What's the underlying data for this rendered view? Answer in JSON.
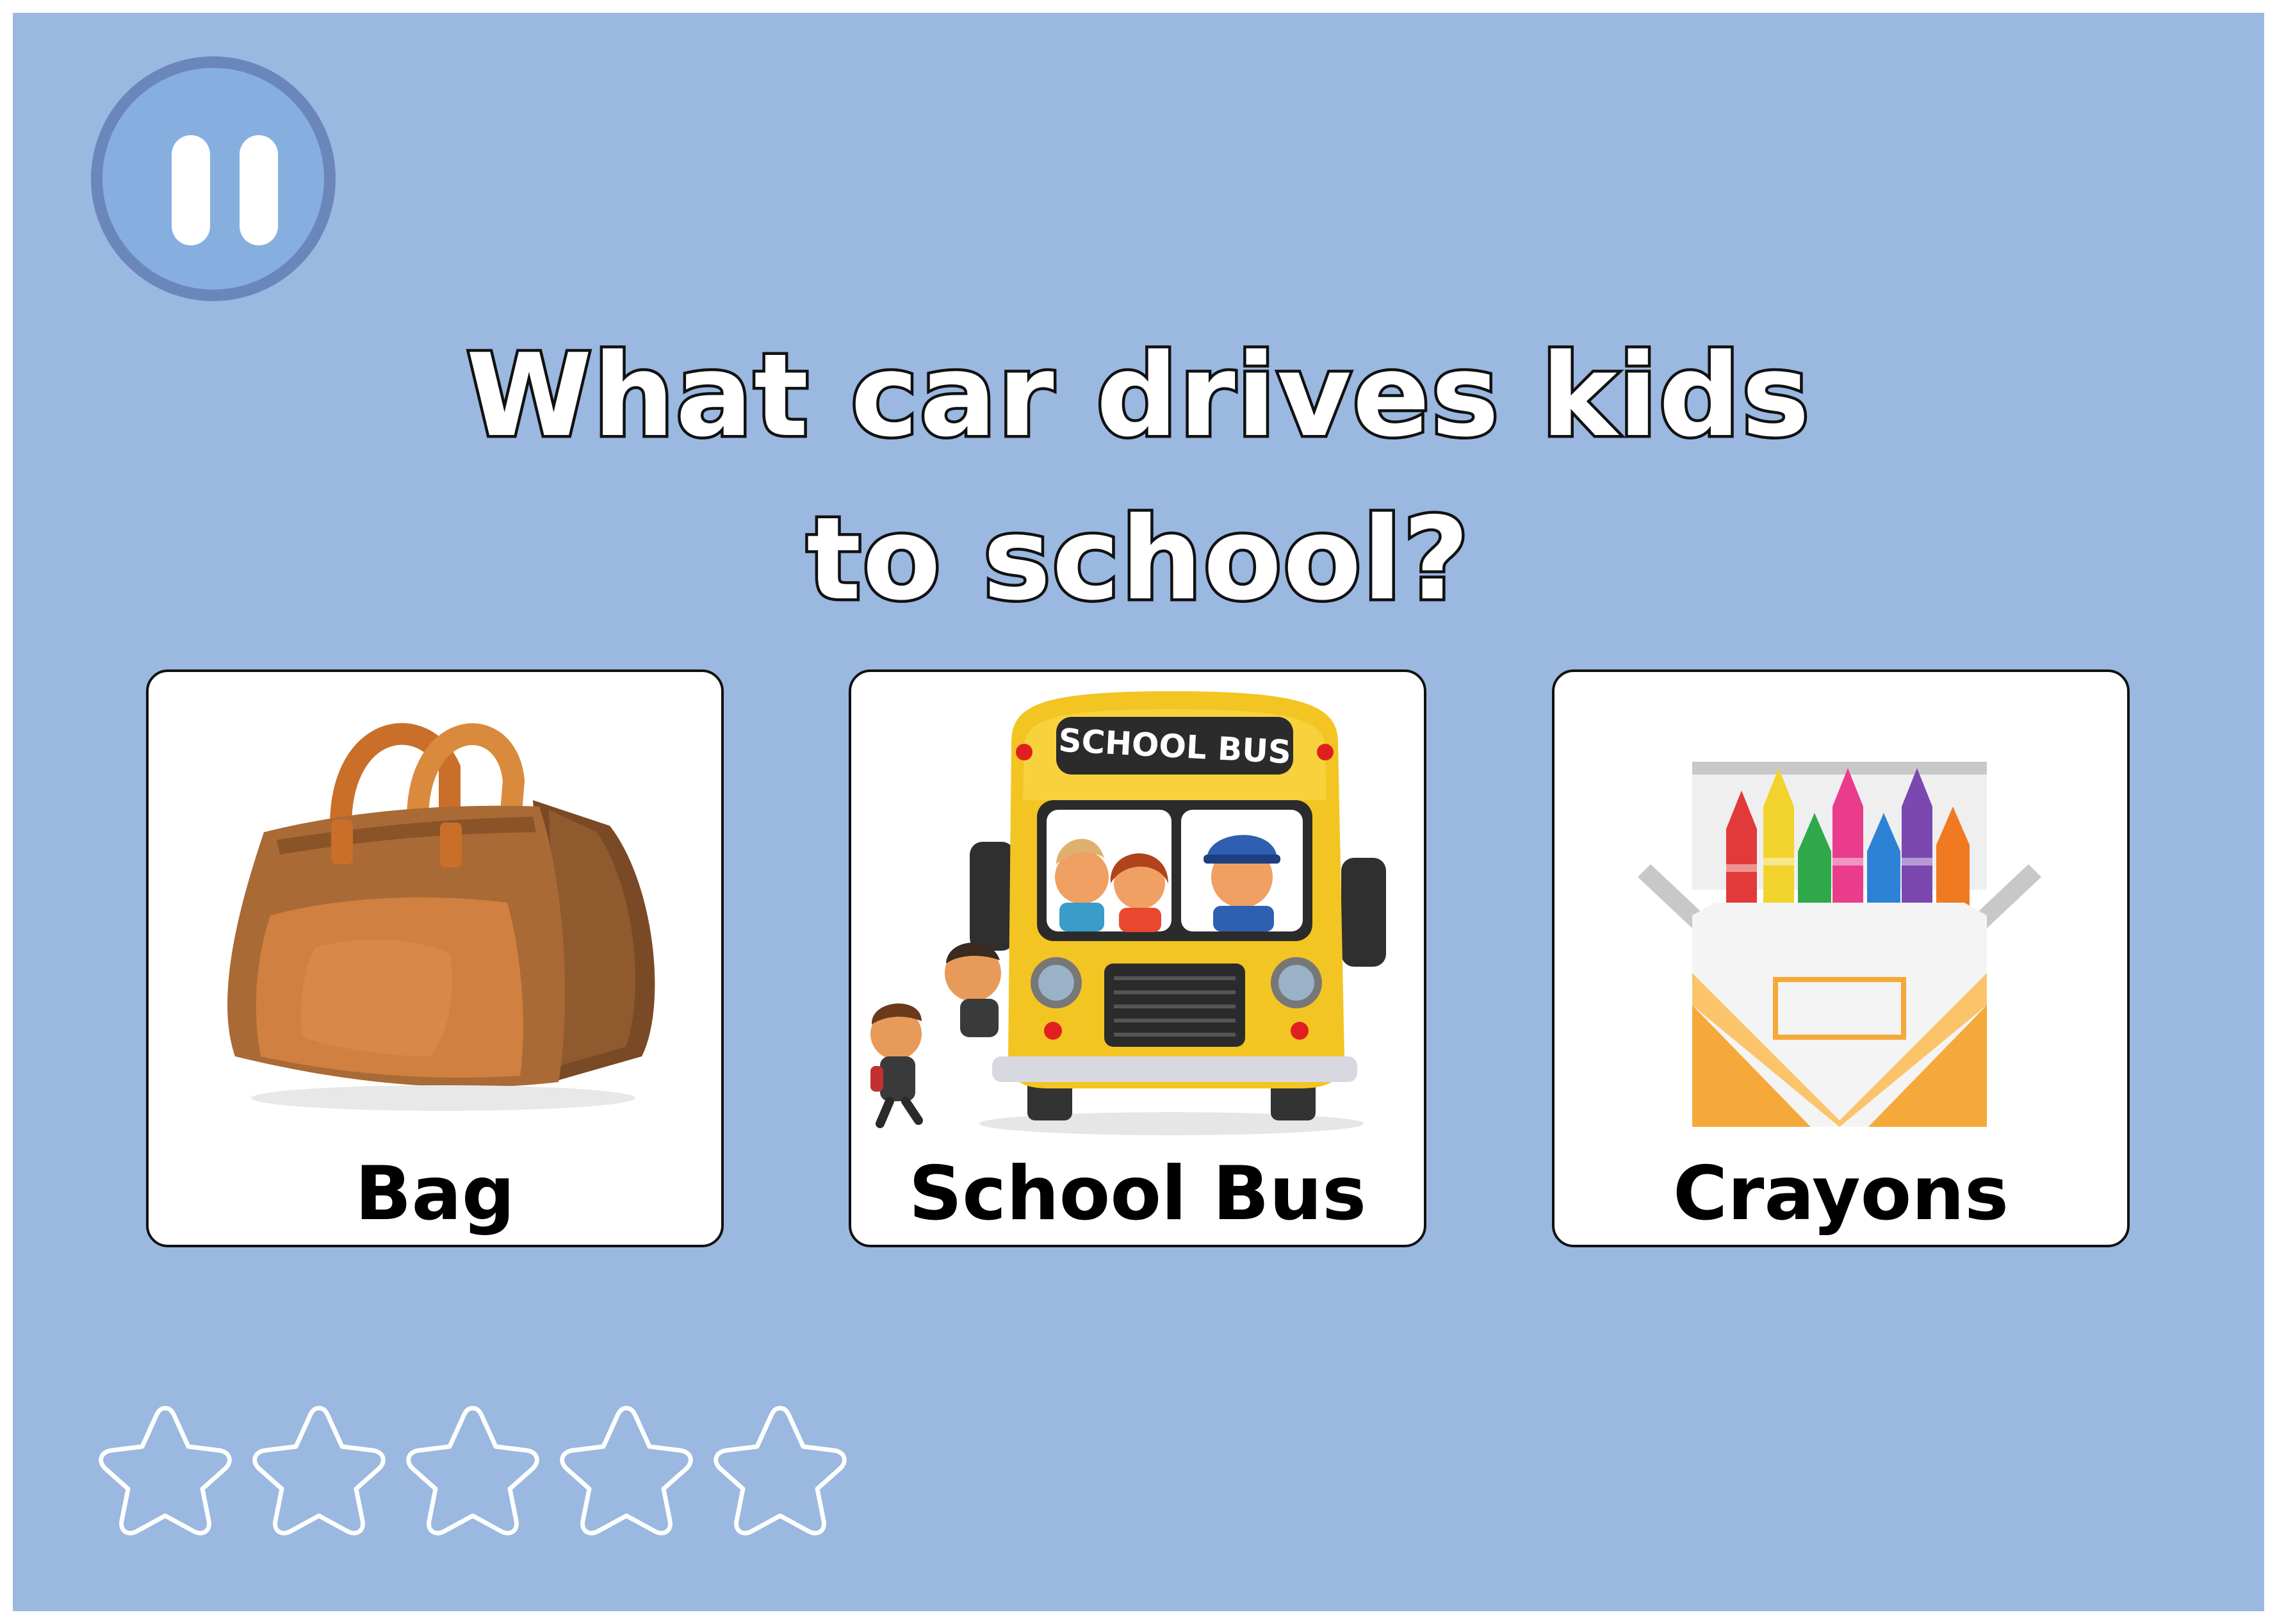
{
  "question": {
    "line1": "What car drives kids",
    "line2": "to school?"
  },
  "pause_button": {
    "icon": "pause-icon"
  },
  "options": [
    {
      "label": "Bag",
      "icon": "bag-icon"
    },
    {
      "label": "School Bus",
      "icon": "school-bus-icon",
      "sign_text": "SCHOOL BUS"
    },
    {
      "label": "Crayons",
      "icon": "crayons-icon"
    }
  ],
  "progress": {
    "stars_total": 5,
    "stars_filled": 0
  },
  "colors": {
    "background": "#9ab8e0",
    "pause_fill": "#86afe0",
    "pause_ring": "#6b86bb",
    "card": "#ffffff",
    "text_outline": "#111111",
    "star_outline": "#ffffff"
  }
}
